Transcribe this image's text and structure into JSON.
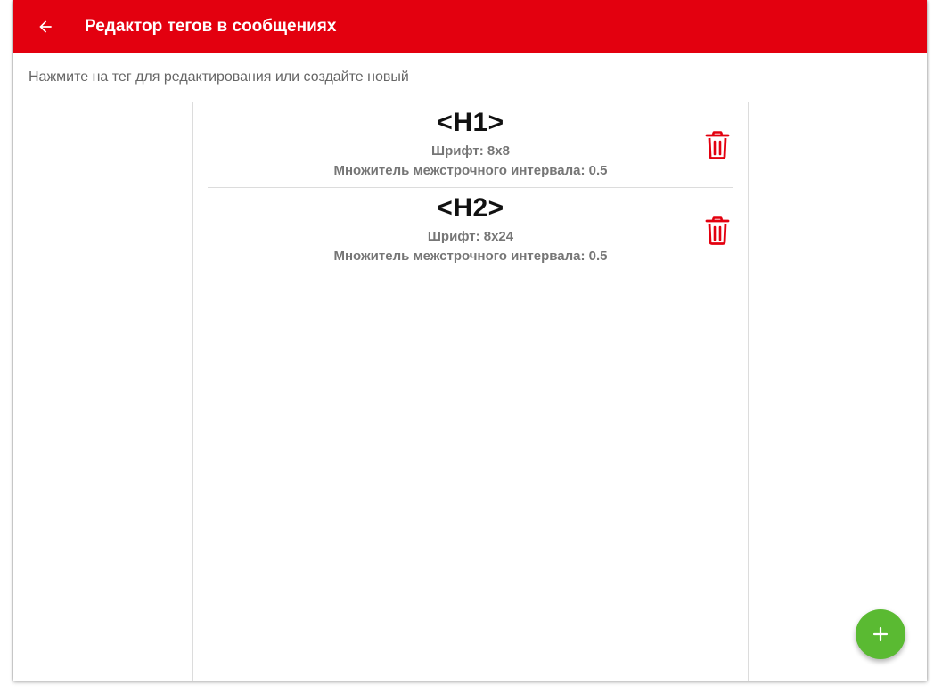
{
  "colors": {
    "appbar": "#e3000f",
    "accent_delete": "#e3000f",
    "fab": "#5aba32"
  },
  "header": {
    "back_icon": "arrow-left-icon",
    "title": "Редактор тегов в сообщениях"
  },
  "hint": "Нажмите на тег для редактирования или создайте новый",
  "tags": [
    {
      "name": "<H1>",
      "font": "Шрифт: 8x8",
      "spacing": "Множитель межстрочного интервала: 0.5",
      "delete_icon": "trash-icon"
    },
    {
      "name": "<H2>",
      "font": "Шрифт: 8x24",
      "spacing": "Множитель межстрочного интервала: 0.5",
      "delete_icon": "trash-icon"
    }
  ],
  "fab": {
    "icon": "plus-icon"
  }
}
